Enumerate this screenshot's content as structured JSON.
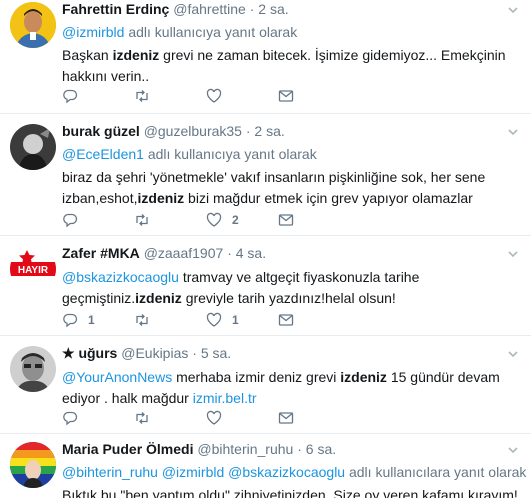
{
  "tweets": [
    {
      "name": "Fahrettin Erdinç",
      "handle": "@fahrettine",
      "sep": "·",
      "time": "2 sa.",
      "reply_link": "@izmirbld",
      "reply_suffix": " adlı kullanıcıya yanıt olarak",
      "text_pre": "Başkan ",
      "text_bold": "izdeniz",
      "text_post": " grevi ne zaman bitecek. İşimize gidemiyoz... Emekçinin hakkını verin..",
      "reply_count": "",
      "retweet_count": "",
      "like_count": ""
    },
    {
      "name": "burak güzel",
      "handle": "@guzelburak35",
      "sep": "·",
      "time": "2 sa.",
      "reply_link": "@EceElden1",
      "reply_suffix": " adlı kullanıcıya yanıt olarak",
      "text_pre": "biraz da şehri 'yönetmekle' vakıf insanların pişkinliğine sok, her sene izban,eshot,",
      "text_bold": "izdeniz",
      "text_post": " bizi mağdur etmek için grev yapıyor olamazlar",
      "reply_count": "",
      "retweet_count": "",
      "like_count": "2"
    },
    {
      "name": "Zafer #MKA",
      "handle": "@zaaaf1907",
      "sep": "·",
      "time": "4 sa.",
      "reply_link": "@bskazizkocaoglu",
      "text_pre": " tramvay ve altgeçit fiyaskonuzla tarihe geçmiştiniz.",
      "text_bold": "izdeniz",
      "text_post": " greviyle tarih yazdınız!helal olsun!",
      "reply_count": "1",
      "retweet_count": "",
      "like_count": "1",
      "avatar_text": "HAYIR"
    },
    {
      "name": "★ uğurs",
      "handle": "@Eukipias",
      "sep": "·",
      "time": "5 sa.",
      "reply_link": "@YourAnonNews",
      "text_pre": " merhaba izmir  deniz grevi ",
      "text_bold": "izdeniz",
      "text_post": " 15 gündür devam ediyor . halk mağdur ",
      "text_link": "izmir.bel.tr",
      "reply_count": "",
      "retweet_count": "",
      "like_count": ""
    },
    {
      "name": "Maria Puder Ölmedi",
      "handle": "@bihterin_ruhu",
      "sep": "·",
      "time": "6 sa.",
      "reply_links": "@bihterin_ruhu @izmirbld @bskazizkocaoglu",
      "reply_suffix": " adlı kullanıcılara yanıt olarak",
      "text": "Bıktık bu \"ben yaptım oldu\" zihniyetinizden. Size oy veren kafamı kırayım!"
    }
  ],
  "colors": {
    "accent": "#1b95e0",
    "muted": "#657786",
    "text": "#14171a",
    "divider": "#e6ecf0"
  },
  "icons": [
    "reply-icon",
    "retweet-icon",
    "like-icon",
    "dm-icon",
    "chevron-down-icon"
  ]
}
